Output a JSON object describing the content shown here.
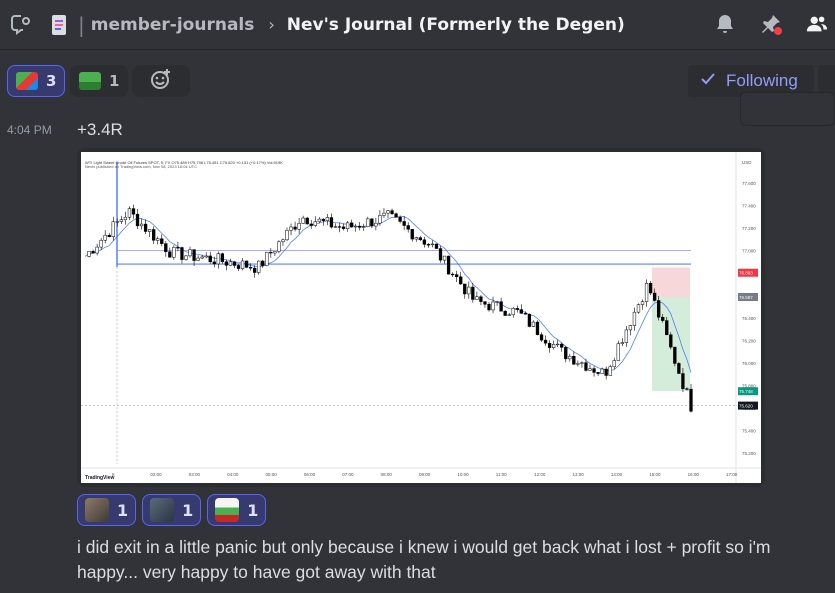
{
  "header": {
    "channel": "member-journals",
    "thread": "Nev's Journal (Formerly the Degen)",
    "icons": [
      "threads-icon",
      "channel-doc-icon",
      "bell-icon",
      "pin-icon",
      "members-icon"
    ]
  },
  "top_reactions": [
    {
      "emoji": "pepe-gamer-emoji",
      "count": "3",
      "active": true
    },
    {
      "emoji": "pepe-emoji",
      "count": "1",
      "active": false
    }
  ],
  "follow": {
    "label": "Following"
  },
  "message": {
    "timestamp": "4:04 PM",
    "text": "+3.4R",
    "chart_title": "WTI Light Sweet Crude Oil Futures SPOT, 5, FX  O75.489  H75.796  L75.451  C75.620  +0.131 (+0.17%)  Vol:919K",
    "chart_source": "Nevfx published on TradingView.com, Nov 08, 2023 16:04 UTC",
    "chart_brand": "TradingView",
    "y_unit": "USD",
    "y_ticks": [
      "77.600",
      "77.400",
      "77.200",
      "77.000",
      "76.800",
      "76.600",
      "76.400",
      "76.200",
      "76.000",
      "75.800",
      "75.600",
      "75.400",
      "75.200"
    ],
    "x_ticks": [
      "8",
      "02:00",
      "03:00",
      "04:00",
      "05:00",
      "06:00",
      "07:00",
      "08:00",
      "09:00",
      "10:00",
      "11:00",
      "12:00",
      "13:00",
      "14:00",
      "15:00",
      "16:00",
      "17:00"
    ],
    "price_labels": {
      "stop": "76.803",
      "entry": "76.587",
      "target": "75.748",
      "last": "75.620"
    }
  },
  "bottom_reactions": [
    {
      "emoji": "avatar-emoji-1",
      "count": "1"
    },
    {
      "emoji": "avatar-emoji-2",
      "count": "1"
    },
    {
      "emoji": "nev-emoji",
      "count": "1"
    }
  ],
  "message2": {
    "text": "i did exit in a little panic but only because i knew i would get back what i lost + profit so i'm happy... very happy to have got away with that"
  },
  "colors": {
    "background": "#313338",
    "accent": "#5865f2",
    "following": "#949cf7"
  },
  "chart_data": {
    "type": "line",
    "x": [
      "02:00",
      "03:00",
      "04:00",
      "05:00",
      "06:00",
      "07:00",
      "08:00",
      "09:00",
      "10:00",
      "11:00",
      "12:00",
      "13:00",
      "14:00",
      "15:00",
      "16:00"
    ],
    "series": [
      {
        "values": [
          76.95,
          77.35,
          76.98,
          76.92,
          76.85,
          77.3,
          77.2,
          77.3,
          77.05,
          76.55,
          76.45,
          76.1,
          75.9,
          76.7,
          75.62
        ]
      }
    ],
    "ylim": [
      75.1,
      77.7
    ]
  }
}
